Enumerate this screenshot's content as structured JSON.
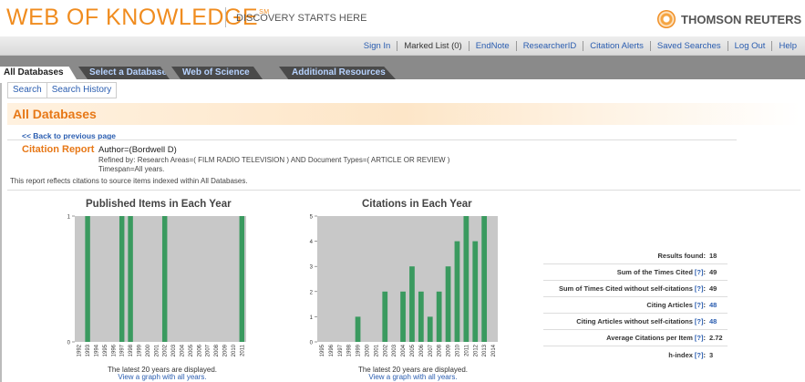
{
  "header": {
    "logo": "WEB OF KNOWLEDGE",
    "logo_sup": "SM",
    "tagline": "DISCOVERY STARTS HERE",
    "brand": "THOMSON REUTERS"
  },
  "util_links": [
    "Sign In",
    "Marked List (0)",
    "EndNote",
    "ResearcherID",
    "Citation Alerts",
    "Saved Searches",
    "Log Out",
    "Help"
  ],
  "tabs": [
    "All Databases",
    "Select a Database",
    "Web of Science",
    "Additional Resources"
  ],
  "subnav": [
    "Search",
    "Search History"
  ],
  "page_title": "All Databases",
  "back_link": "<< Back to previous page",
  "report": {
    "title": "Citation Report",
    "author": "Author=(Bordwell D)",
    "refined": "Refined by: Research Areas=( FILM RADIO TELEVISION ) AND Document Types=( ARTICLE OR REVIEW )",
    "timespan": "Timespan=All years.",
    "note": "This report reflects citations to source items indexed within All Databases."
  },
  "chart_data": [
    {
      "type": "bar",
      "title": "Published Items in Each Year",
      "categories": [
        "1992",
        "1993",
        "1994",
        "1995",
        "1996",
        "1997",
        "1998",
        "1999",
        "2000",
        "2001",
        "2002",
        "2003",
        "2004",
        "2005",
        "2006",
        "2007",
        "2008",
        "2009",
        "2010",
        "2011"
      ],
      "values": [
        0,
        1,
        0,
        0,
        0,
        1,
        1,
        0,
        0,
        0,
        1,
        0,
        0,
        0,
        0,
        0,
        0,
        0,
        0,
        1
      ],
      "yticks": [
        0,
        1
      ],
      "ylim": [
        0,
        1
      ],
      "bar_color": "#3a9a5f",
      "background": "#c8c8c8",
      "note": "The latest 20 years are displayed.",
      "link": "View a graph with all years."
    },
    {
      "type": "bar",
      "title": "Citations in Each Year",
      "categories": [
        "1995",
        "1996",
        "1997",
        "1998",
        "1999",
        "2000",
        "2001",
        "2002",
        "2003",
        "2004",
        "2005",
        "2006",
        "2007",
        "2008",
        "2009",
        "2010",
        "2011",
        "2012",
        "2013",
        "2014"
      ],
      "values": [
        0,
        0,
        0,
        0,
        1,
        0,
        0,
        2,
        0,
        2,
        3,
        2,
        1,
        2,
        3,
        4,
        5,
        4,
        5,
        0
      ],
      "yticks": [
        0,
        1,
        2,
        3,
        4,
        5
      ],
      "ylim": [
        0,
        5
      ],
      "bar_color": "#3a9a5f",
      "background": "#c8c8c8",
      "note": "The latest 20 years are displayed.",
      "link": "View a graph with all years."
    }
  ],
  "stats": [
    {
      "label": "Results found:",
      "help": "",
      "value": "18",
      "blue": false
    },
    {
      "label": "Sum of the Times Cited",
      "help": "[?]",
      "value": "49",
      "blue": false
    },
    {
      "label": "Sum of Times Cited without self-citations",
      "help": "[?]",
      "value": "49",
      "blue": false
    },
    {
      "label": "Citing Articles",
      "help": "[?]",
      "value": "48",
      "blue": true
    },
    {
      "label": "Citing Articles without self-citations",
      "help": "[?]",
      "value": "48",
      "blue": true
    },
    {
      "label": "Average Citations per Item",
      "help": "[?]",
      "value": "2.72",
      "blue": false
    },
    {
      "label": "h-index",
      "help": "[?]",
      "value": "3",
      "blue": false
    }
  ]
}
